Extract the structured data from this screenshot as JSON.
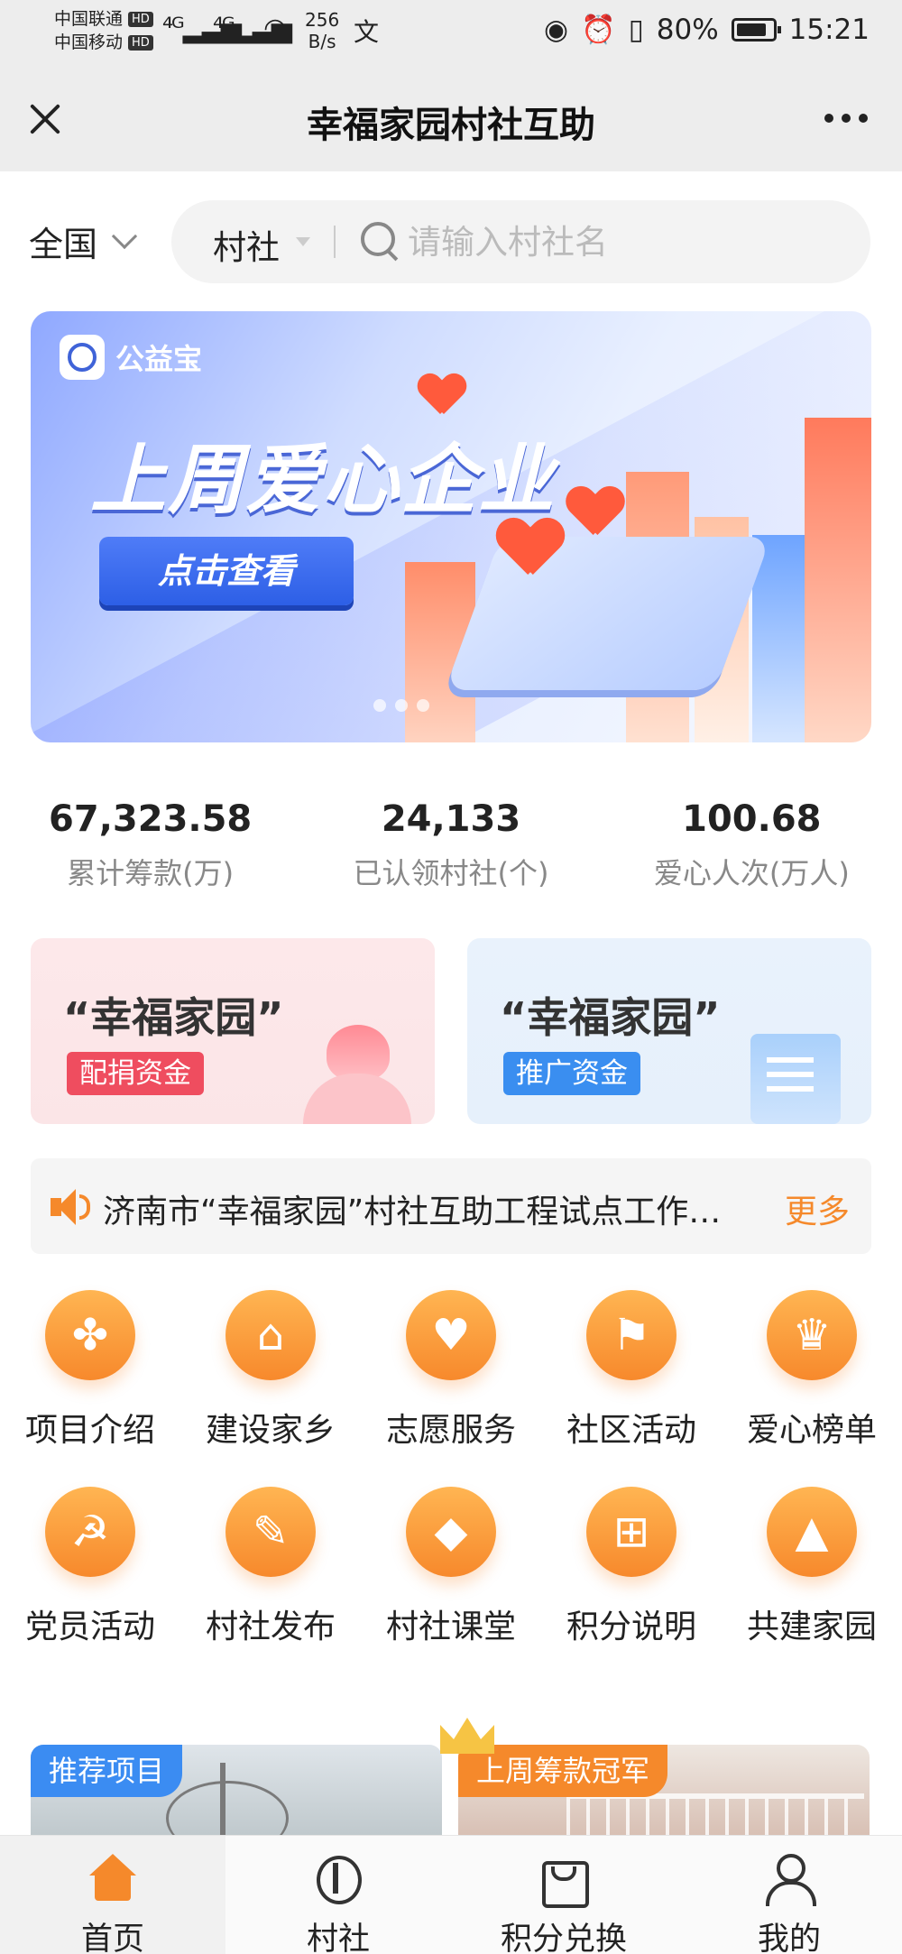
{
  "status_bar": {
    "carrier1": "中国联通",
    "carrier2": "中国移动",
    "hd": "HD",
    "net_speed_value": "256",
    "net_speed_unit": "B/s",
    "battery": "80%",
    "time": "15:21"
  },
  "title_bar": {
    "title": "幸福家园村社互助"
  },
  "search": {
    "region": "全国",
    "type": "村社",
    "placeholder": "请输入村社名"
  },
  "banner": {
    "logo_text": "公益宝",
    "headline": "上周爱心企业",
    "cta": "点击查看"
  },
  "stats": [
    {
      "value": "67,323.58",
      "label": "累计筹款(万)"
    },
    {
      "value": "24,133",
      "label": "已认领村社(个)"
    },
    {
      "value": "100.68",
      "label": "爱心人次(万人)"
    }
  ],
  "funds": [
    {
      "title": "“幸福家园”",
      "tag": "配捐资金"
    },
    {
      "title": "“幸福家园”",
      "tag": "推广资金"
    }
  ],
  "notice": {
    "text": "济南市“幸福家园”村社互助工程试点工作…",
    "more": "更多"
  },
  "grid": [
    {
      "label": "项目介绍",
      "icon": "clover-icon"
    },
    {
      "label": "建设家乡",
      "icon": "house-icon"
    },
    {
      "label": "志愿服务",
      "icon": "heart-hands-icon"
    },
    {
      "label": "社区活动",
      "icon": "flag-hand-icon"
    },
    {
      "label": "爱心榜单",
      "icon": "crown-icon"
    },
    {
      "label": "党员活动",
      "icon": "party-member-icon"
    },
    {
      "label": "村社发布",
      "icon": "edit-icon"
    },
    {
      "label": "村社课堂",
      "icon": "graduation-cap-icon"
    },
    {
      "label": "积分说明",
      "icon": "gift-icon"
    },
    {
      "label": "共建家园",
      "icon": "mountain-icon"
    }
  ],
  "promos": [
    {
      "chip": "推荐项目"
    },
    {
      "chip": "上周筹款冠军"
    }
  ],
  "tabs": [
    {
      "label": "首页",
      "icon": "home-icon"
    },
    {
      "label": "村社",
      "icon": "village-icon"
    },
    {
      "label": "积分兑换",
      "icon": "shopping-bag-icon"
    },
    {
      "label": "我的",
      "icon": "user-icon"
    }
  ],
  "colors": {
    "accent": "#f5892b",
    "blue": "#3a8ef0",
    "pink": "#ef4d5f"
  }
}
